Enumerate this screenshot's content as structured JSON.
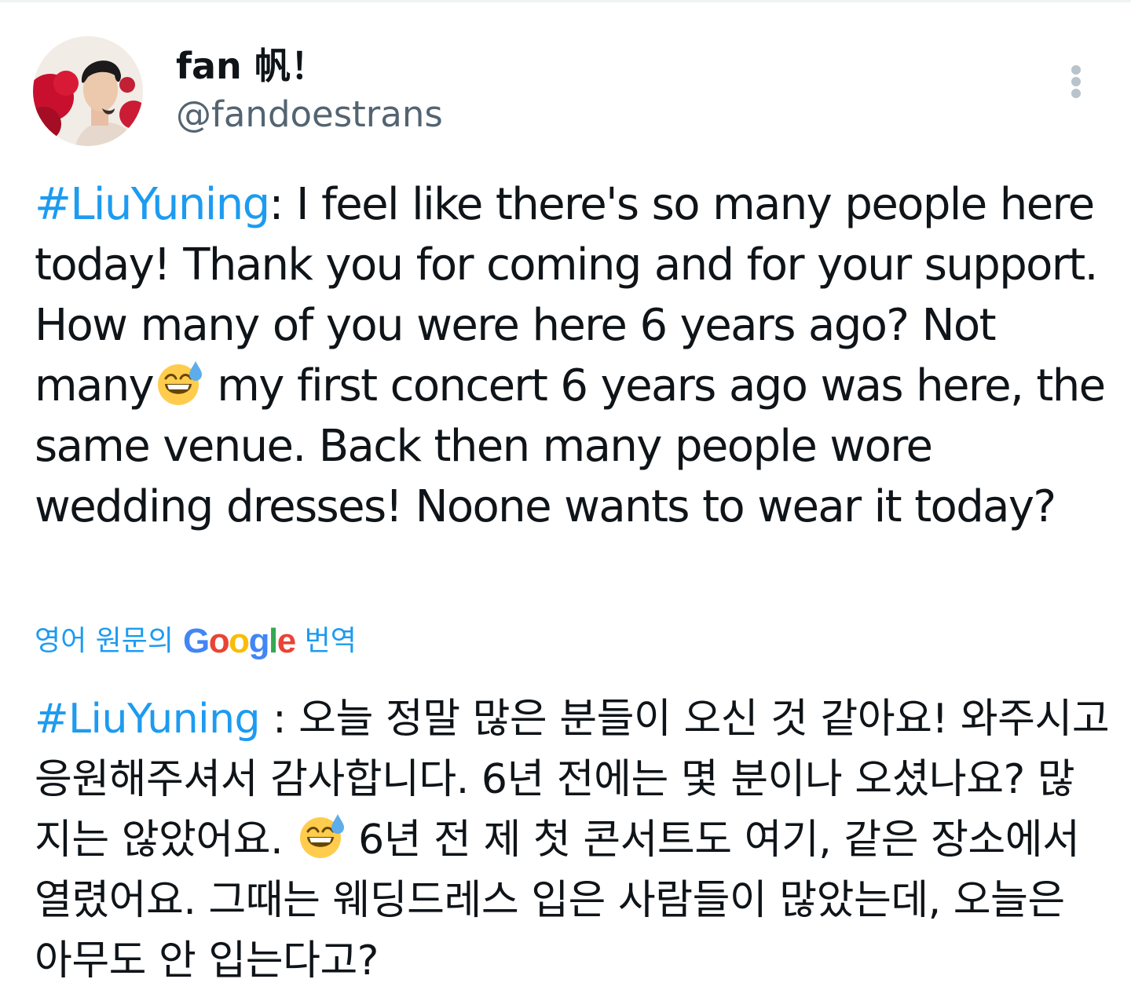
{
  "tweet": {
    "author": {
      "display_name": "fan 帆！",
      "handle": "@fandoestrans",
      "avatar": "profile-photo"
    },
    "more_icon": "more-vertical-icon",
    "text": {
      "hashtag": "#LiuYuning",
      "before_emoji": ": I feel like there's so many people here today! Thank you for coming and for your support. How many of you were here 6 years ago? Not many",
      "emoji": "sweat-smile-emoji",
      "after_emoji": " my first concert 6 years ago was here, the same venue. Back then many people wore wedding dresses! Noone wants to wear it today?"
    },
    "translation_bar": {
      "prefix": "영어 원문의",
      "brand": {
        "G": "G",
        "o1": "o",
        "o2": "o",
        "g": "g",
        "l": "l",
        "e": "e"
      },
      "suffix": "번역",
      "brand_colors": {
        "blue": "#4285f4",
        "red": "#ea4335",
        "yellow": "#fbbc05",
        "green": "#34a853"
      }
    },
    "translated_text": {
      "hashtag": "#LiuYuning",
      "before_emoji": " : 오늘 정말 많은 분들이 오신 것 같아요! 와주시고 응원해주셔서 감사합니다. 6년 전에는 몇 분이나 오셨나요? 많지는 않았어요. ",
      "emoji": "sweat-smile-emoji",
      "after_emoji": " 6년 전 제 첫 콘서트도 여기, 같은 장소에서 열렸어요. 그때는 웨딩드레스 입은 사람들이 많았는데, 오늘은 아무도 안 입는다고?"
    }
  },
  "colors": {
    "text": "#0f1419",
    "secondary": "#536471",
    "link": "#1d9bf0"
  }
}
